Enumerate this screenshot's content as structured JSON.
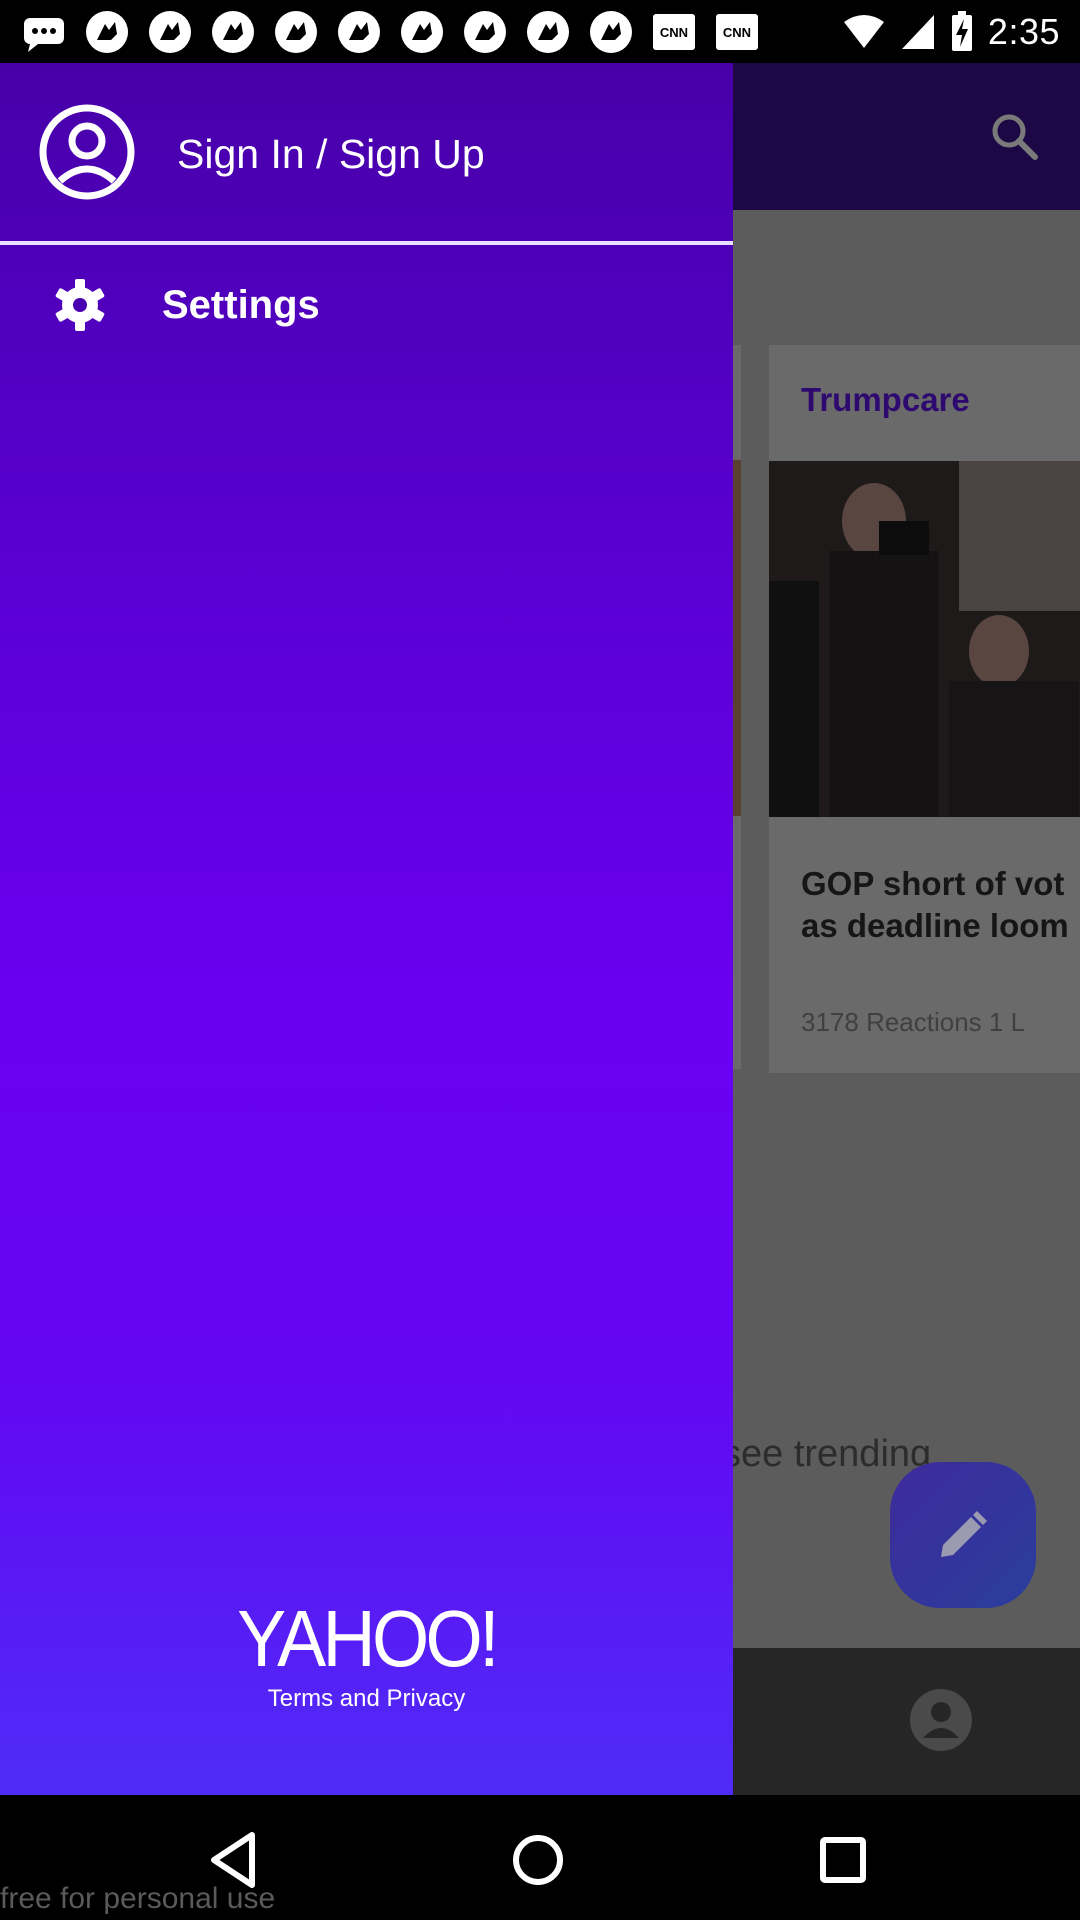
{
  "status_bar": {
    "time": "2:35",
    "notification_icons": [
      "message-icon",
      "instrument-icon",
      "instrument-icon",
      "instrument-icon",
      "instrument-icon",
      "instrument-icon",
      "instrument-icon",
      "instrument-icon",
      "instrument-icon",
      "instrument-icon",
      "cnn-icon",
      "cnn-icon"
    ],
    "cnn_badge": "CNN"
  },
  "drawer": {
    "signin_label": "Sign In / Sign Up",
    "settings_label": "Settings",
    "logo_text": "YAHOO!",
    "terms_label": "Terms and Privacy"
  },
  "background_app": {
    "card_title": "Trumpcare",
    "card_headline": "GOP short of vot\nas deadline loom",
    "card_meta": "3178 Reactions    1 L",
    "trending_text": "see trending"
  },
  "watermark": "free for personal use",
  "colors": {
    "drawer_top": "#4700a8",
    "drawer_bottom": "#4f2cf7",
    "toolbar": "#1c0844",
    "card_title": "#2e0a70"
  }
}
